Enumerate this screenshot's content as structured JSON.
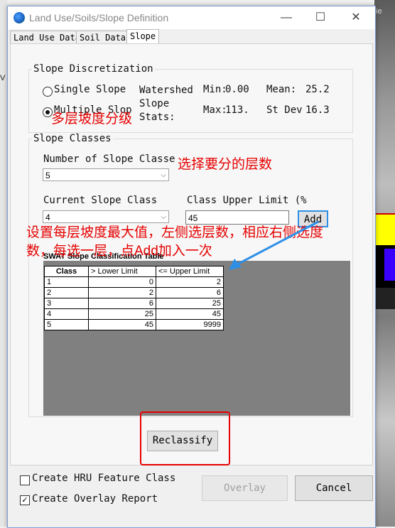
{
  "window": {
    "title": "Land Use/Soils/Slope Definition"
  },
  "tabs": [
    {
      "label": "Land Use Data"
    },
    {
      "label": "Soil Data"
    },
    {
      "label": "Slope"
    }
  ],
  "discretization": {
    "title": "Slope Discretization",
    "single_label": "Single Slope",
    "multiple_label": "Multiple Slop",
    "selected": "multiple",
    "stats_label": "Watershed Slope Stats:",
    "min_label": "Min:",
    "min_value": "0.00",
    "mean_label": "Mean:",
    "mean_value": "25.2",
    "max_label": "Max:",
    "max_value": "113.",
    "stdev_label": "St Dev",
    "stdev_value": "16.3"
  },
  "classes": {
    "title": "Slope Classes",
    "number_label": "Number of Slope Classe",
    "number_value": "5",
    "current_label": "Current Slope Class",
    "current_value": "4",
    "upper_label": "Class Upper Limit (%",
    "upper_value": "45",
    "add_label": "Add"
  },
  "table": {
    "title": "SWAT Slope Classification Table",
    "headers": [
      "Class",
      "> Lower Limit",
      "<= Upper Limit"
    ],
    "rows": [
      [
        "1",
        "0",
        "2"
      ],
      [
        "2",
        "2",
        "6"
      ],
      [
        "3",
        "6",
        "25"
      ],
      [
        "4",
        "25",
        "45"
      ],
      [
        "5",
        "45",
        "9999"
      ]
    ]
  },
  "reclassify_label": "Reclassify",
  "footer": {
    "hru_label": "Create HRU Feature Class",
    "hru_checked": false,
    "report_label": "Create Overlay Report",
    "report_checked": true,
    "overlay_label": "Overlay",
    "cancel_label": "Cancel"
  },
  "annotations": {
    "multi_level": "多层坡度分级",
    "choose_levels": "选择要分的层数",
    "set_max_1": "设置每层坡度最大值，左侧选层数，相应右侧选度",
    "set_max_2": "数，每选一层，点Add加入一次"
  },
  "background": {
    "strip_text": "ie",
    "left_text": "V"
  },
  "colors": {
    "annotation": "#e60000",
    "highlight": "#2e8fe6",
    "table_bg": "#808080"
  }
}
